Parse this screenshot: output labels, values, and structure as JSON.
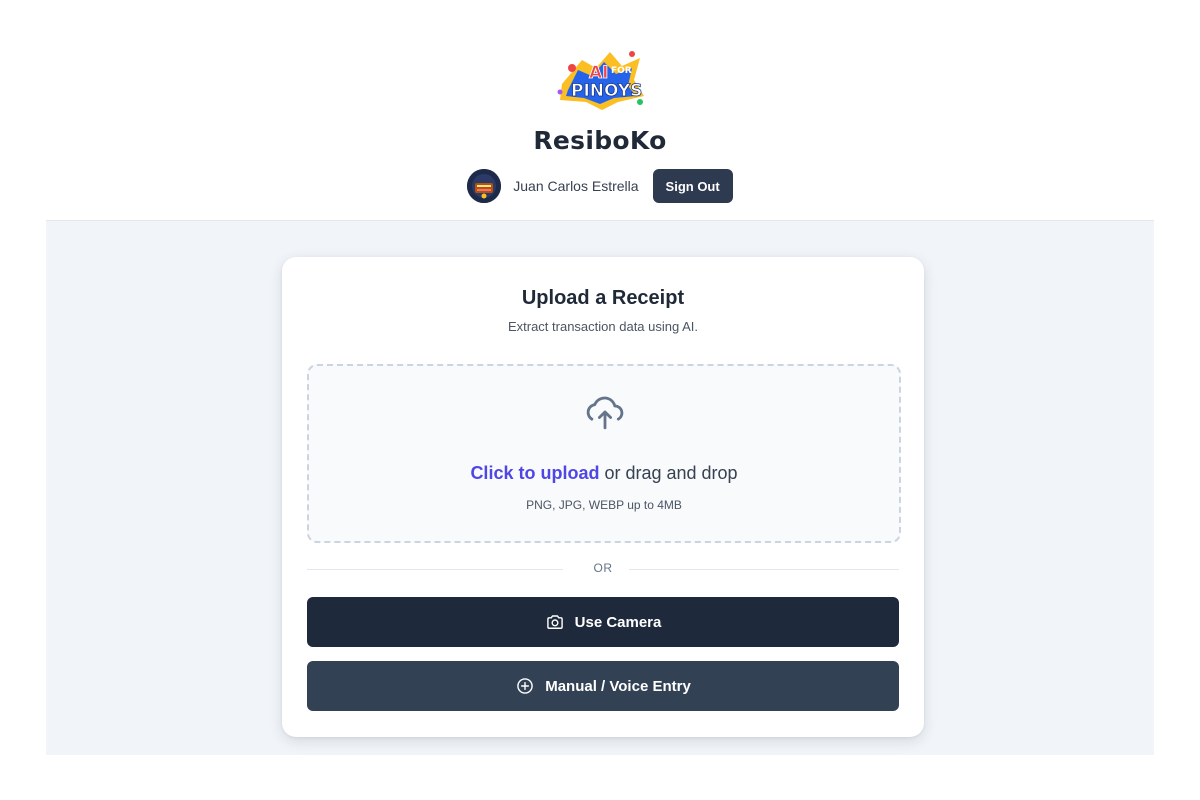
{
  "header": {
    "logo_text_top": "AI",
    "logo_text_small": "FOR",
    "logo_text_bottom": "PINOYS",
    "app_title": "ResiboKo",
    "user_name": "Juan Carlos Estrella",
    "sign_out_label": "Sign Out"
  },
  "card": {
    "title": "Upload a Receipt",
    "subtitle": "Extract transaction data using AI.",
    "dropzone": {
      "link_text": "Click to upload",
      "rest_text": " or drag and drop",
      "hint": "PNG, JPG, WEBP up to 4MB",
      "icon": "cloud-upload-icon"
    },
    "divider_text": "OR",
    "camera_button": {
      "label": "Use Camera",
      "icon": "camera-icon"
    },
    "manual_button": {
      "label": "Manual / Voice Entry",
      "icon": "plus-circle-icon"
    }
  },
  "colors": {
    "primary_dark": "#1e293b",
    "secondary_dark": "#334155",
    "link": "#4f46e5",
    "background": "#f1f5f9"
  }
}
